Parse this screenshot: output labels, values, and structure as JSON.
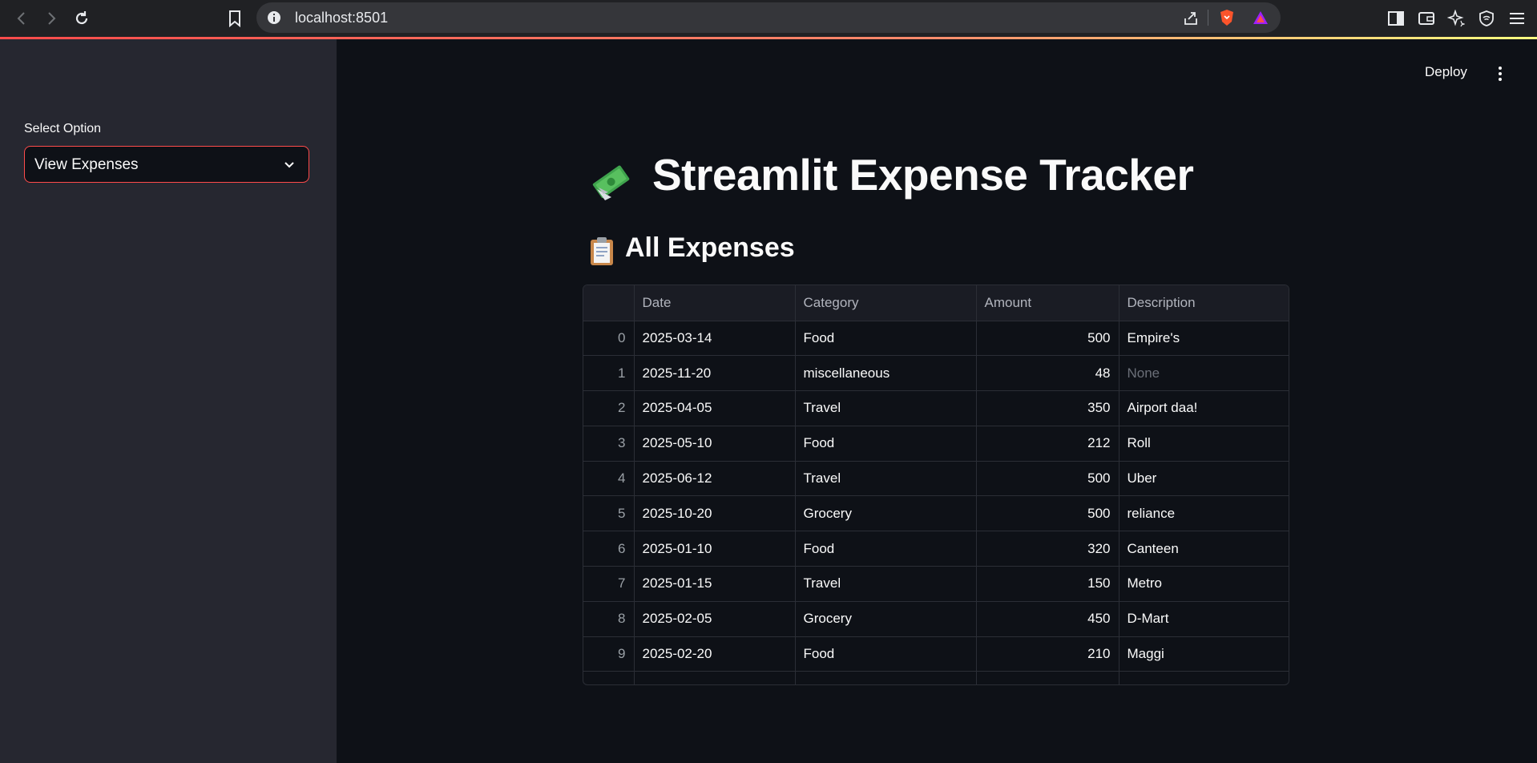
{
  "browser": {
    "url": "localhost:8501"
  },
  "sidebar": {
    "select_label": "Select Option",
    "select_value": "View Expenses"
  },
  "header": {
    "deploy_label": "Deploy"
  },
  "main": {
    "title": "Streamlit Expense Tracker",
    "subheader": "All Expenses",
    "table": {
      "columns": [
        "",
        "Date",
        "Category",
        "Amount",
        "Description"
      ],
      "rows": [
        {
          "index": "0",
          "date": "2025-03-14",
          "category": "Food",
          "amount": "500",
          "description": "Empire's"
        },
        {
          "index": "1",
          "date": "2025-11-20",
          "category": "miscellaneous",
          "amount": "48",
          "description": "None"
        },
        {
          "index": "2",
          "date": "2025-04-05",
          "category": "Travel",
          "amount": "350",
          "description": "Airport daa!"
        },
        {
          "index": "3",
          "date": "2025-05-10",
          "category": "Food",
          "amount": "212",
          "description": "Roll"
        },
        {
          "index": "4",
          "date": "2025-06-12",
          "category": "Travel",
          "amount": "500",
          "description": "Uber"
        },
        {
          "index": "5",
          "date": "2025-10-20",
          "category": "Grocery",
          "amount": "500",
          "description": "reliance"
        },
        {
          "index": "6",
          "date": "2025-01-10",
          "category": "Food",
          "amount": "320",
          "description": "Canteen"
        },
        {
          "index": "7",
          "date": "2025-01-15",
          "category": "Travel",
          "amount": "150",
          "description": "Metro"
        },
        {
          "index": "8",
          "date": "2025-02-05",
          "category": "Grocery",
          "amount": "450",
          "description": "D-Mart"
        },
        {
          "index": "9",
          "date": "2025-02-20",
          "category": "Food",
          "amount": "210",
          "description": "Maggi"
        }
      ]
    }
  },
  "icons": {
    "title_icon": "money-with-wings-icon",
    "subheader_icon": "clipboard-icon"
  },
  "colors": {
    "accent": "#ff4b4b",
    "background": "#0e1117",
    "sidebar": "#262730"
  }
}
